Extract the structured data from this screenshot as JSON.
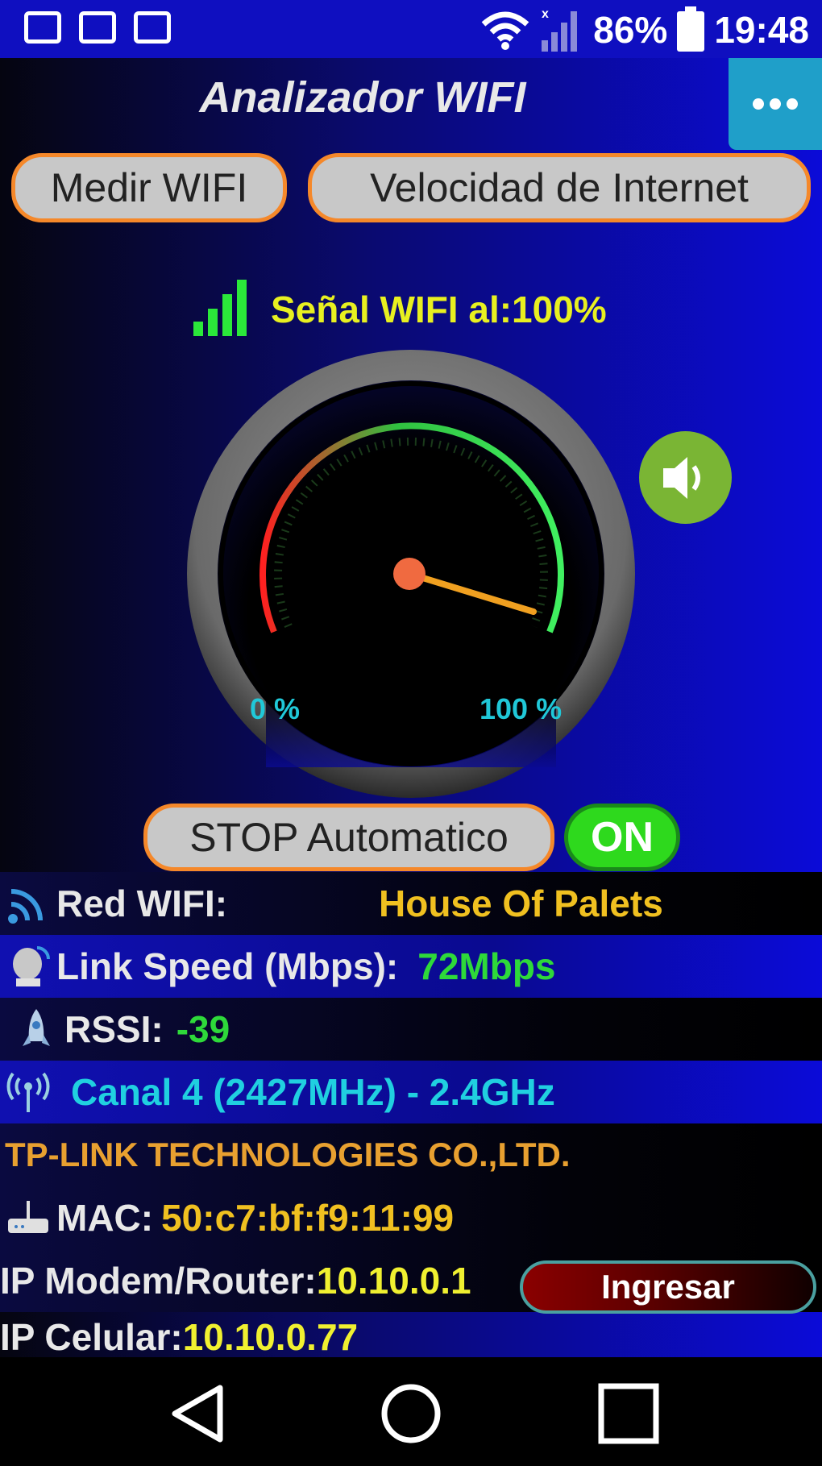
{
  "status_bar": {
    "battery": "86%",
    "time": "19:48",
    "icons": [
      "image-icon",
      "monitor-icon",
      "monitor-icon",
      "wifi-icon",
      "cell-signal-icon",
      "battery-icon"
    ]
  },
  "app": {
    "title": "Analizador WIFI",
    "menu_icon": "more-dots-icon"
  },
  "buttons": {
    "measure_wifi": "Medir WIFI",
    "internet_speed": "Velocidad de Internet",
    "stop_auto": "STOP Automatico",
    "toggle_state": "ON",
    "router_login": "Ingresar"
  },
  "signal": {
    "label": "Señal WIFI al:100%",
    "percent": 100
  },
  "gauge": {
    "min_label": "0 %",
    "max_label": "100 %",
    "value": 100
  },
  "info": {
    "network_label": "Red WIFI:",
    "network_value": "House Of Palets",
    "link_label": "Link Speed (Mbps):",
    "link_value": "72Mbps",
    "rssi_label": "RSSI:",
    "rssi_value": "-39",
    "channel": "Canal 4 (2427MHz) - 2.4GHz",
    "vendor": "TP-LINK TECHNOLOGIES CO.,LTD.",
    "mac_label": "MAC:",
    "mac_value": "50:c7:bf:f9:11:99",
    "router_label": "IP Modem/Router:",
    "router_value": "10.10.0.1",
    "phone_label": "IP Celular:",
    "phone_value": "10.10.0.77"
  },
  "colors": {
    "accent_orange": "#f5882a",
    "toggle_green": "#2ed91d",
    "value_yellow": "#f0c020",
    "value_green": "#2ed93a",
    "value_cyan": "#20d0e0"
  }
}
